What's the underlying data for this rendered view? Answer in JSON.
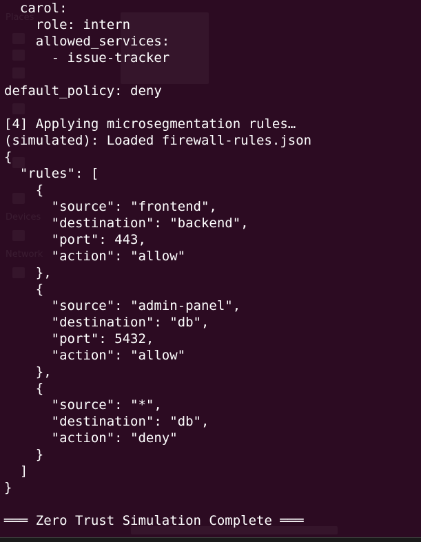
{
  "terminal": {
    "lines": [
      "  carol:",
      "    role: intern",
      "    allowed_services:",
      "      - issue-tracker",
      "",
      "default_policy: deny",
      "",
      "[4] Applying microsegmentation rules…",
      "(simulated): Loaded firewall-rules.json",
      "{",
      "  \"rules\": [",
      "    {",
      "      \"source\": \"frontend\",",
      "      \"destination\": \"backend\",",
      "      \"port\": 443,",
      "      \"action\": \"allow\"",
      "    },",
      "    {",
      "      \"source\": \"admin-panel\",",
      "      \"destination\": \"db\",",
      "      \"port\": 5432,",
      "      \"action\": \"allow\"",
      "    },",
      "    {",
      "      \"source\": \"*\",",
      "      \"destination\": \"db\",",
      "      \"action\": \"deny\"",
      "    }",
      "  ]",
      "}",
      "",
      "═══ Zero Trust Simulation Complete ═══"
    ]
  },
  "colors": {
    "terminal_background": "#2c0b22",
    "text": "#ffffff"
  }
}
